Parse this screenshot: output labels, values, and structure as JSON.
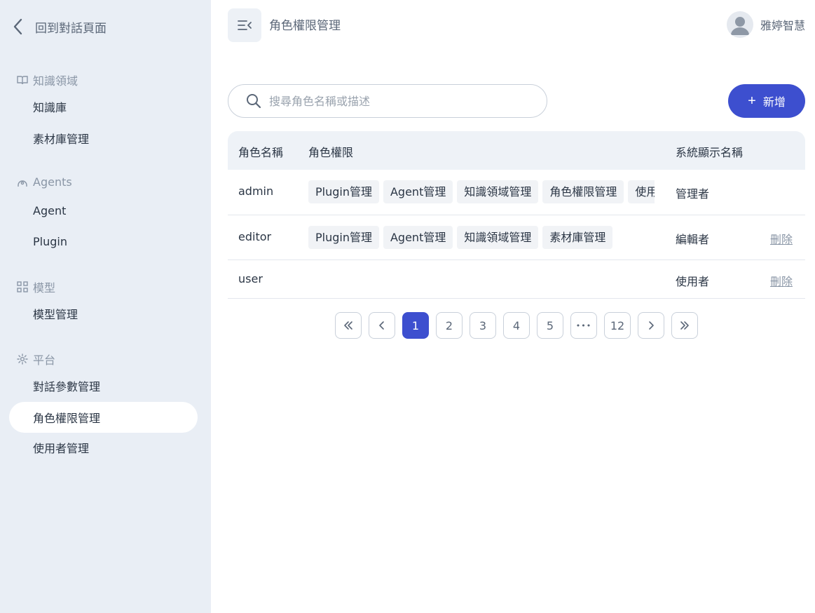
{
  "sidebar": {
    "back_label": "回到對話頁面",
    "groups": [
      {
        "title": "知識領域",
        "icon": "book-icon",
        "items": [
          "知識庫",
          "素材庫管理"
        ]
      },
      {
        "title": "Agents",
        "icon": "agent-icon",
        "items": [
          "Agent",
          "Plugin"
        ]
      },
      {
        "title": "模型",
        "icon": "grid-icon",
        "items": [
          "模型管理"
        ]
      },
      {
        "title": "平台",
        "icon": "gear-icon",
        "items": [
          "對話參數管理",
          "角色權限管理",
          "使用者管理"
        ]
      }
    ],
    "active_item": "角色權限管理"
  },
  "header": {
    "title": "角色權限管理",
    "user_name": "雅婷智慧"
  },
  "search": {
    "placeholder": "搜尋角色名稱或描述",
    "value": ""
  },
  "add_button": {
    "label": "新增"
  },
  "table": {
    "columns": [
      "角色名稱",
      "角色權限",
      "系統顯示名稱"
    ],
    "rows": [
      {
        "name": "admin",
        "permissions": [
          "Plugin管理",
          "Agent管理",
          "知識領域管理",
          "角色權限管理",
          "使用者管理"
        ],
        "display_name": "管理者",
        "action": ""
      },
      {
        "name": "editor",
        "permissions": [
          "Plugin管理",
          "Agent管理",
          "知識領域管理",
          "素材庫管理"
        ],
        "display_name": "編輯者",
        "action": "刪除"
      },
      {
        "name": "user",
        "permissions": [],
        "display_name": "使用者",
        "action": "刪除"
      }
    ]
  },
  "pagination": {
    "first": "«",
    "prev": "‹",
    "pages": [
      "1",
      "2",
      "3",
      "4",
      "5",
      "•••",
      "12"
    ],
    "current": "1",
    "next": "›",
    "last": "»"
  },
  "colors": {
    "accent": "#3d4fcf",
    "sidebar_bg": "#e9eef5"
  }
}
